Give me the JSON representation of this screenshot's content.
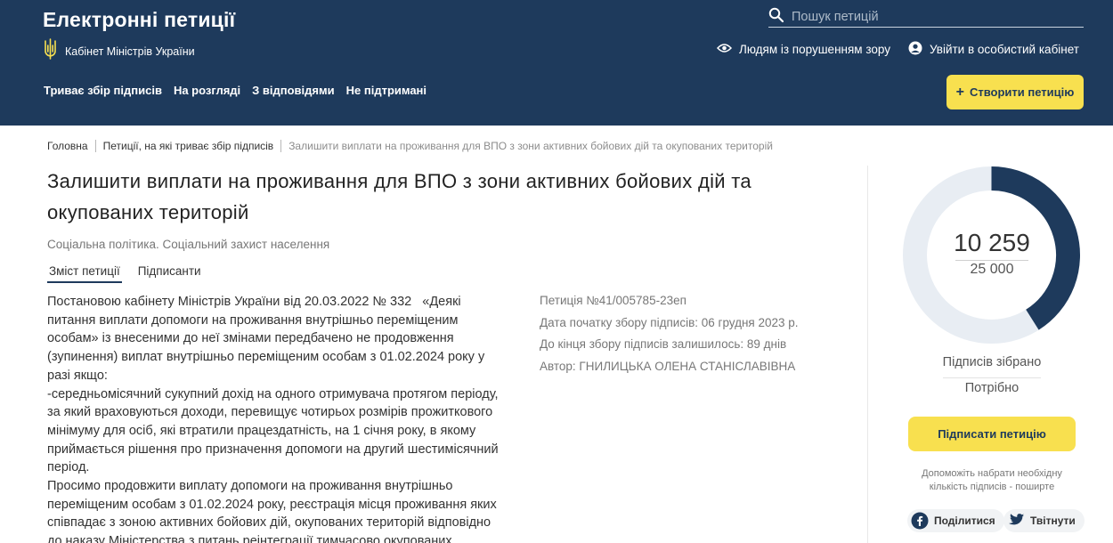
{
  "header": {
    "site_title": "Електронні петиції",
    "org_label": "Кабінет Міністрів України",
    "search_placeholder": "Пошук петицій",
    "accessibility_label": "Людям із порушенням зору",
    "login_label": "Увійти в особистий кабінет",
    "nav": [
      {
        "label": "Триває збір підписів"
      },
      {
        "label": "На розгляді"
      },
      {
        "label": "З відповідями"
      },
      {
        "label": "Не підтримані"
      }
    ],
    "create_label": "Створити петицію",
    "colors": {
      "background": "#1e3a5c",
      "accent": "#f8e04f"
    }
  },
  "breadcrumb": [
    {
      "label": "Головна"
    },
    {
      "label": "Петиції, на які триває збір підписів"
    },
    {
      "label": "Залишити виплати на проживання для ВПО з зони активних бойових дій та окупованих територій"
    }
  ],
  "petition": {
    "title": "Залишити виплати на проживання для ВПО з зони активних бойових дій та окупованих територій",
    "category": "Соціальна політика. Соціальний захист населення",
    "tabs": [
      {
        "label": "Зміст петиції"
      },
      {
        "label": "Підписанти"
      }
    ],
    "body": "Постановою кабінету Міністрів України від 20.03.2022 № 332   «Деякі питання виплати допомоги на проживання внутрішньо переміщеним особам» із внесеними до неї змінами передбачено не продовження (зупинення) виплат внутрішньо переміщеним особам з 01.02.2024 року у разі якщо:\n-середньомісячний сукупний дохід на одного отримувача протягом періоду, за який враховуються доходи, перевищує чотирьох розмірів прожиткового мінімуму для осіб, які втратили працездатність, на 1 січня року, в якому приймається рішення про призначення допомоги на другий шестимісячний період.\nПросимо продовжити виплату допомоги на проживання внутрішньо переміщеним особам з 01.02.2024 року, реєстрація місця проживання яких співпадає з зоною активних бойових дій, окупованих територій відповідно до наказу Міністерства з питань реінтеграції тимчасово окупованих",
    "meta": {
      "number": "Петиція №41/005785-23еп",
      "start_date": "Дата початку збору підписів: 06 грудня 2023 р.",
      "days_left": "До кінця збору підписів залишилось: 89 днів",
      "author": "Автор: ГНИЛИЦЬКА ОЛЕНА СТАНІСЛАВІВНА"
    }
  },
  "sidebar": {
    "collected_display": "10 259",
    "goal_display": "25 000",
    "collected": 10259,
    "goal": 25000,
    "collected_label": "Підписів зібрано",
    "needed_label": "Потрібно",
    "sign_label": "Підписати петицію",
    "help_text": "Допоможіть набрати необхідну кількість підписів - поширте",
    "share_facebook": "Поділитися",
    "share_twitter": "Твітнути",
    "colors": {
      "progress": "#1e3a5c",
      "track": "#e8edf3"
    }
  }
}
